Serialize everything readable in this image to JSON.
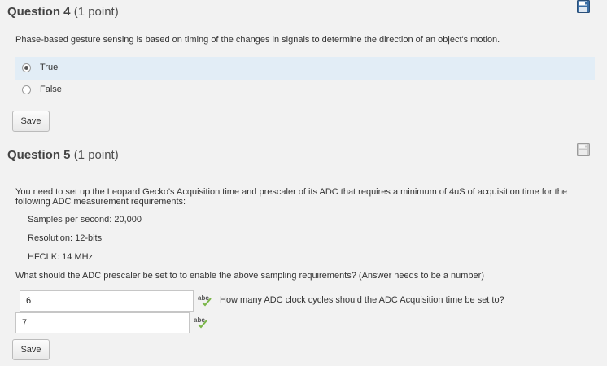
{
  "q4": {
    "title": "Question 4",
    "points": "(1 point)",
    "prompt": "Phase-based gesture sensing is based on timing of the changes in signals to determine the direction of an object's motion.",
    "options": [
      {
        "label": "True",
        "selected": true
      },
      {
        "label": "False",
        "selected": false
      }
    ],
    "save_label": "Save",
    "save_icon": "floppy-disk-icon"
  },
  "q5": {
    "title": "Question 5",
    "points": "(1 point)",
    "prompt_line1": "You need to set up the Leopard Gecko's Acquisition time and prescaler of its ADC that requires a minimum of 4uS of acquisition time for the",
    "prompt_line2": "following ADC measurement requirements:",
    "req_samples": "Samples per second:  20,000",
    "req_resolution": "Resolution:  12-bits",
    "req_hfclk": "HFCLK:  14 MHz",
    "sub_question1": "What should the ADC prescaler be set to to enable the above sampling requirements? (Answer needs to be a number)",
    "answer1": "6",
    "sub_question2": "How many ADC clock cycles should the ADC Acquisition time be set to?",
    "answer2": "7",
    "spellcheck_label": "abc",
    "save_label": "Save",
    "save_icon": "floppy-disk-icon"
  },
  "colors": {
    "selected_bg": "#e2edf6",
    "save_icon_blue": "#3a6ea5",
    "spell_green": "#7ab648"
  }
}
